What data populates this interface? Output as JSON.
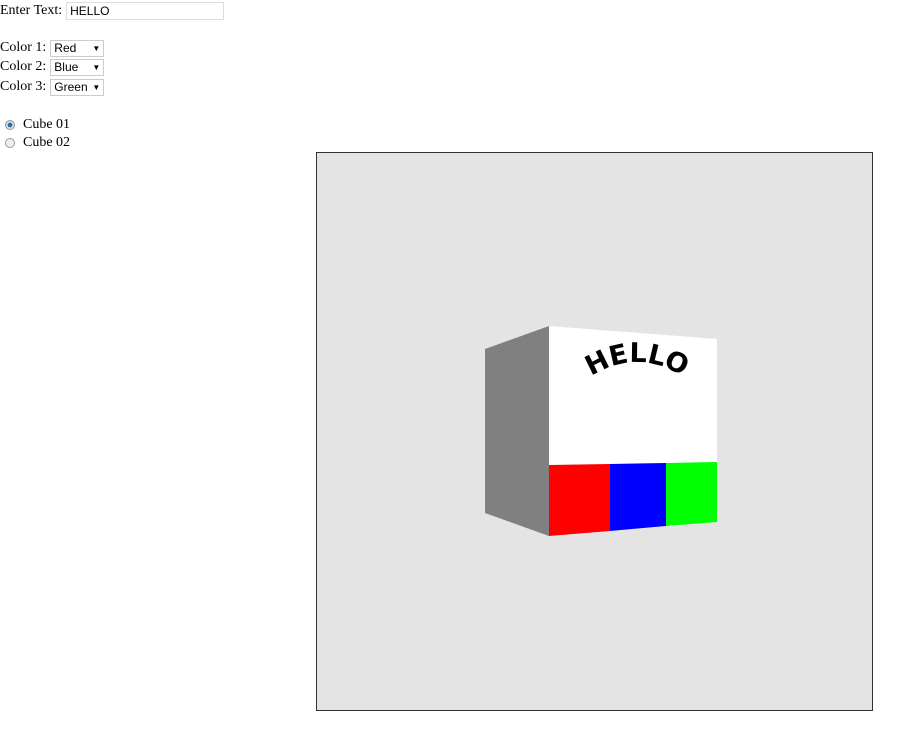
{
  "text_input": {
    "label": "Enter Text:",
    "value": "HELLO"
  },
  "colors": [
    {
      "label": "Color 1:",
      "value": "Red"
    },
    {
      "label": "Color 2:",
      "value": "Blue"
    },
    {
      "label": "Color 3:",
      "value": "Green"
    }
  ],
  "radios": [
    {
      "label": "Cube 01",
      "checked": true
    },
    {
      "label": "Cube 02",
      "checked": false
    }
  ],
  "cube": {
    "text": "HELLO",
    "stripe_colors": [
      "#ff0000",
      "#0000ff",
      "#00ff00"
    ],
    "face_color": "#ffffff",
    "side_color": "#808080",
    "background": "#e4e4e4"
  }
}
